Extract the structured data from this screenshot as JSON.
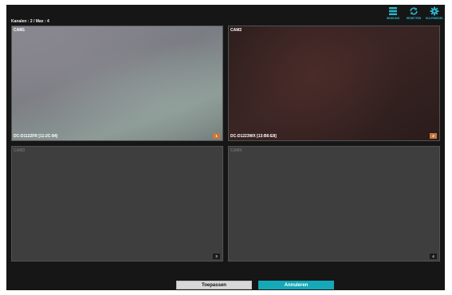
{
  "header": {
    "channel_info": "Kanalen : 2 / Max : 4"
  },
  "toolbar": {
    "items": [
      {
        "label": "INDELING",
        "icon": "layout-icon"
      },
      {
        "label": "RESETTEN",
        "icon": "refresh-icon"
      },
      {
        "label": "HULPMIDDEL",
        "icon": "gear-icon"
      }
    ],
    "accent": "#2eb4cc"
  },
  "cameras": [
    {
      "label": "CAM1",
      "model": "DC-D1122FR [11:2C:84]",
      "badge": "1",
      "active": true
    },
    {
      "label": "CAM2",
      "model": "DC-D1223WX [13:B6:E8]",
      "badge": "2",
      "active": true
    },
    {
      "label": "CAM3",
      "model": "",
      "badge": "3",
      "active": false
    },
    {
      "label": "CAM4",
      "model": "",
      "badge": "4",
      "active": false
    }
  ],
  "buttons": {
    "apply": "Toepassen",
    "cancel": "Annuleren"
  },
  "colors": {
    "badge_active": "#c9763a",
    "cancel": "#15a8b8"
  }
}
